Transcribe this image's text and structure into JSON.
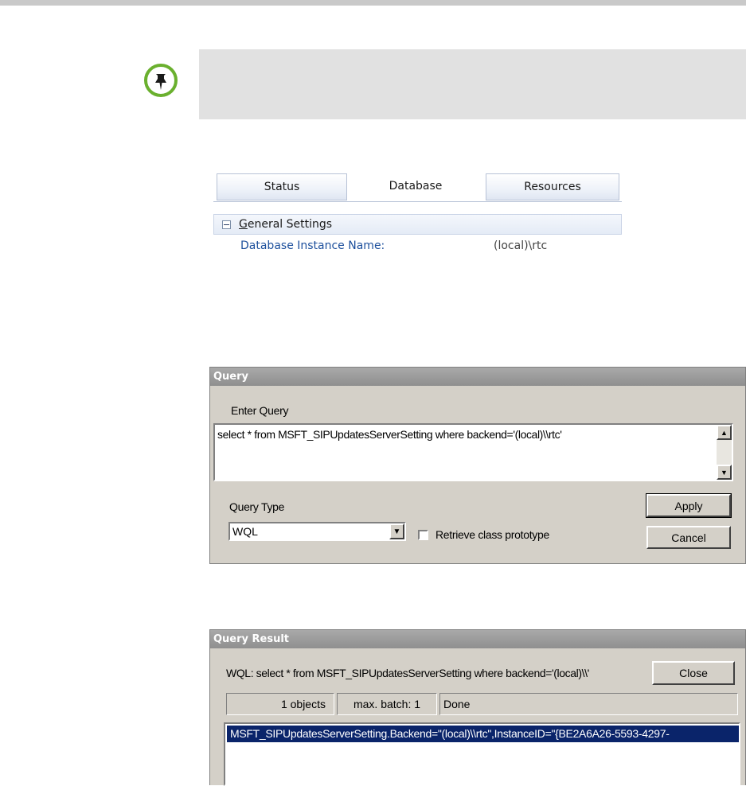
{
  "colors": {
    "note_background": "#e1e1e1",
    "pin_ring": "#6ab02e",
    "dialog_face": "#d4d0c8",
    "selection": "#0a246a",
    "setting_label": "#1c4f9c"
  },
  "console": {
    "tabs": [
      {
        "label": "Status",
        "active": false
      },
      {
        "label": "Database",
        "active": true
      },
      {
        "label": "Resources",
        "active": false
      }
    ],
    "group": {
      "title_first_letter": "G",
      "title_rest": "eneral Settings",
      "collapse_icon": "minus-box-icon"
    },
    "setting": {
      "label": "Database Instance Name:",
      "value": "(local)\\rtc"
    }
  },
  "query_dialog": {
    "title": "Query",
    "enter_query_label": "Enter Query",
    "query_text": "select * from MSFT_SIPUpdatesServerSetting where backend='(local)\\\\rtc'",
    "query_type_label": "Query Type",
    "query_type_value": "WQL",
    "retrieve_label": "Retrieve class prototype",
    "retrieve_checked": false,
    "apply_label": "Apply",
    "cancel_label": "Cancel"
  },
  "result_dialog": {
    "title": "Query Result",
    "wql_text": "WQL: select * from MSFT_SIPUpdatesServerSetting where backend='(local)\\\\'",
    "close_label": "Close",
    "status": {
      "objects": "1 objects",
      "batch": "max. batch: 1",
      "state": "Done"
    },
    "results": [
      "MSFT_SIPUpdatesServerSetting.Backend=\"(local)\\\\rtc\",InstanceID=\"{BE2A6A26-5593-4297-"
    ]
  }
}
